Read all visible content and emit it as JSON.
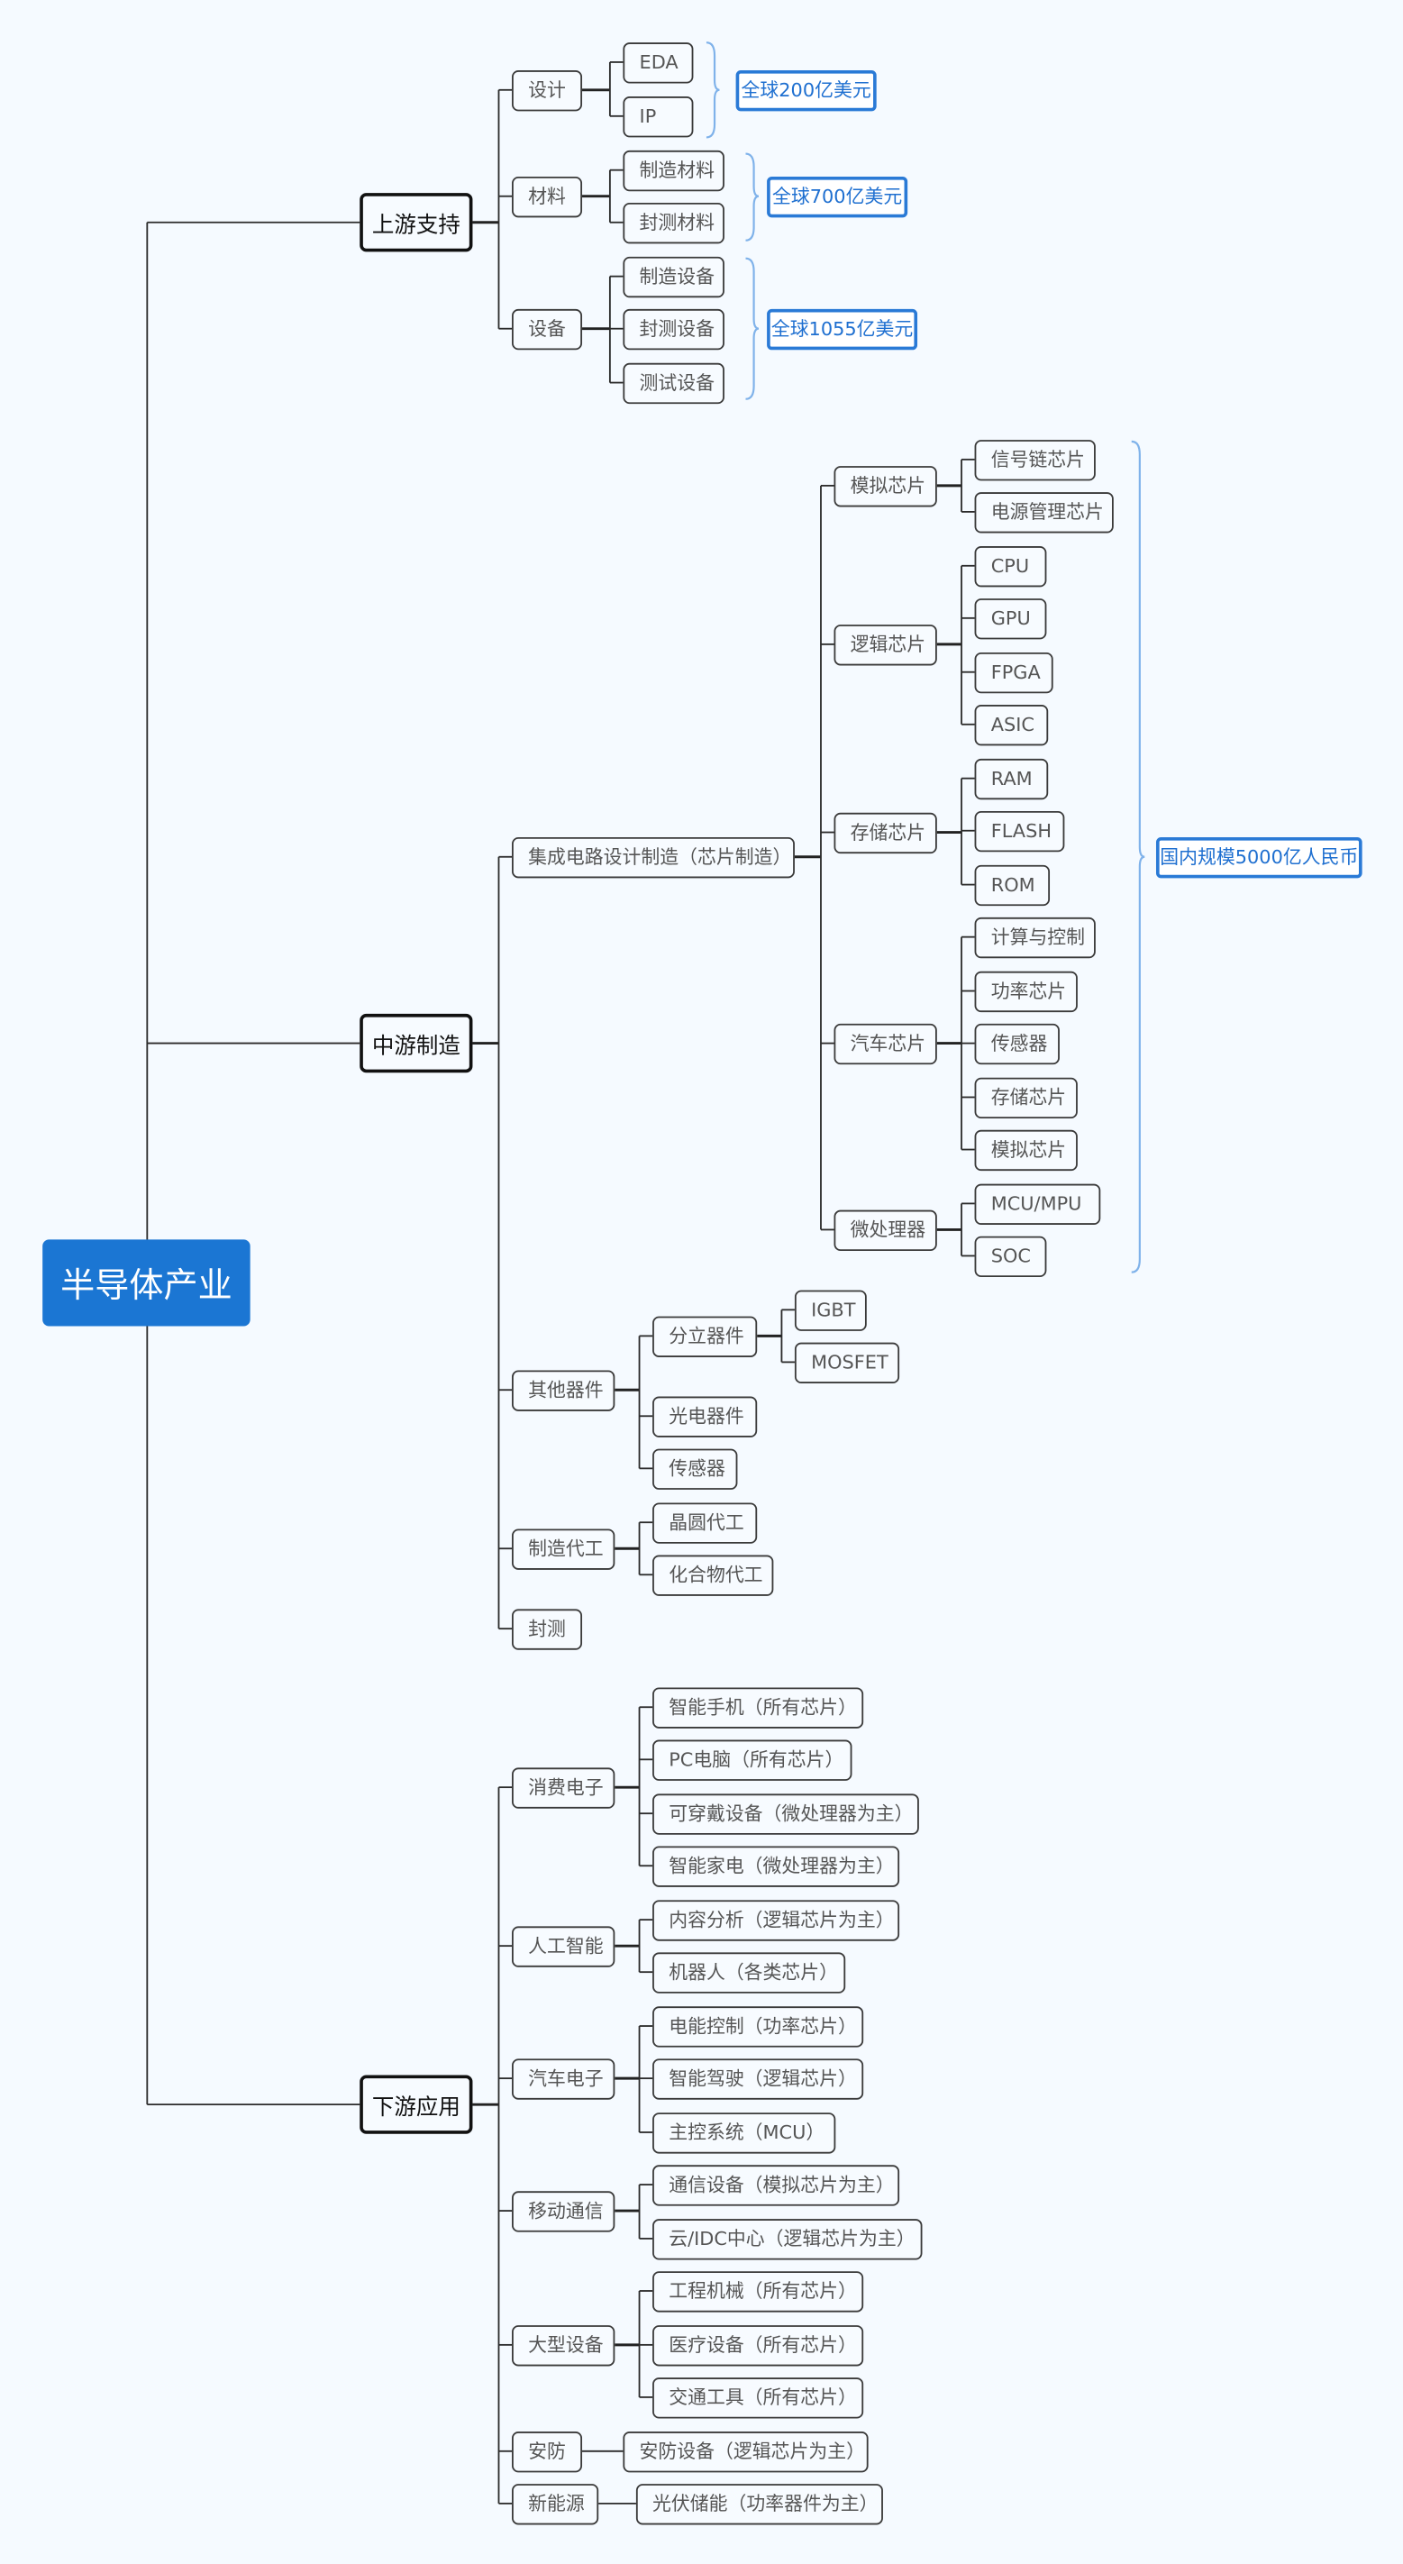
{
  "root": {
    "label": "半导体产业"
  },
  "colors": {
    "root_fill": "#1b76d3",
    "summary_accent": "#2a7ad6",
    "brace": "#7fb2ea",
    "background": "#f5faff"
  },
  "branches": [
    {
      "label": "上游支持",
      "children": [
        {
          "label": "设计",
          "children": [
            {
              "label": "EDA"
            },
            {
              "label": "IP"
            }
          ]
        },
        {
          "label": "材料",
          "children": [
            {
              "label": "制造材料"
            },
            {
              "label": "封测材料"
            }
          ]
        },
        {
          "label": "设备",
          "children": [
            {
              "label": "制造设备"
            },
            {
              "label": "封测设备"
            },
            {
              "label": "测试设备"
            }
          ]
        }
      ]
    },
    {
      "label": "中游制造",
      "children": [
        {
          "label": "集成电路设计制造（芯片制造）",
          "children": [
            {
              "label": "模拟芯片",
              "children": [
                {
                  "label": "信号链芯片"
                },
                {
                  "label": "电源管理芯片"
                }
              ]
            },
            {
              "label": "逻辑芯片",
              "children": [
                {
                  "label": "CPU"
                },
                {
                  "label": "GPU"
                },
                {
                  "label": "FPGA"
                },
                {
                  "label": "ASIC"
                }
              ]
            },
            {
              "label": "存储芯片",
              "children": [
                {
                  "label": "RAM"
                },
                {
                  "label": "FLASH"
                },
                {
                  "label": "ROM"
                }
              ]
            },
            {
              "label": "汽车芯片",
              "children": [
                {
                  "label": "计算与控制"
                },
                {
                  "label": "功率芯片"
                },
                {
                  "label": "传感器"
                },
                {
                  "label": "存储芯片"
                },
                {
                  "label": "模拟芯片"
                }
              ]
            },
            {
              "label": "微处理器",
              "children": [
                {
                  "label": "MCU/MPU"
                },
                {
                  "label": "SOC"
                }
              ]
            }
          ]
        },
        {
          "label": "其他器件",
          "children": [
            {
              "label": "分立器件",
              "children": [
                {
                  "label": "IGBT"
                },
                {
                  "label": "MOSFET"
                }
              ]
            },
            {
              "label": "光电器件"
            },
            {
              "label": "传感器"
            }
          ]
        },
        {
          "label": "制造代工",
          "children": [
            {
              "label": "晶圆代工"
            },
            {
              "label": "化合物代工"
            }
          ]
        },
        {
          "label": "封测"
        }
      ]
    },
    {
      "label": "下游应用",
      "children": [
        {
          "label": "消费电子",
          "children": [
            {
              "label": "智能手机（所有芯片）"
            },
            {
              "label": "PC电脑（所有芯片）"
            },
            {
              "label": "可穿戴设备（微处理器为主）"
            },
            {
              "label": "智能家电（微处理器为主）"
            }
          ]
        },
        {
          "label": "人工智能",
          "children": [
            {
              "label": "内容分析（逻辑芯片为主）"
            },
            {
              "label": "机器人（各类芯片）"
            }
          ]
        },
        {
          "label": "汽车电子",
          "children": [
            {
              "label": "电能控制（功率芯片）"
            },
            {
              "label": "智能驾驶（逻辑芯片）"
            },
            {
              "label": "主控系统（MCU）"
            }
          ]
        },
        {
          "label": "移动通信",
          "children": [
            {
              "label": "通信设备（模拟芯片为主）"
            },
            {
              "label": "云/IDC中心（逻辑芯片为主）"
            }
          ]
        },
        {
          "label": "大型设备",
          "children": [
            {
              "label": "工程机械（所有芯片）"
            },
            {
              "label": "医疗设备（所有芯片）"
            },
            {
              "label": "交通工具（所有芯片）"
            }
          ]
        },
        {
          "label": "安防",
          "children": [
            {
              "label": "安防设备（逻辑芯片为主）"
            }
          ]
        },
        {
          "label": "新能源",
          "children": [
            {
              "label": "光伏储能（功率器件为主）"
            }
          ]
        }
      ]
    }
  ],
  "summaries": [
    {
      "label": "全球200亿美元"
    },
    {
      "label": "全球700亿美元"
    },
    {
      "label": "全球1055亿美元"
    },
    {
      "label": "国内规模5000亿人民币"
    }
  ]
}
